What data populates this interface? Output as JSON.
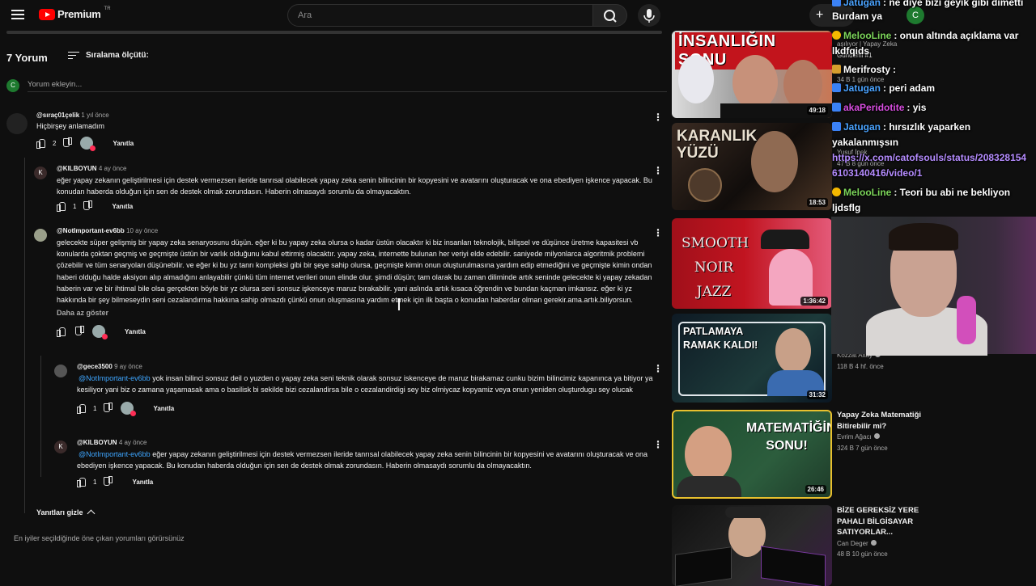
{
  "header": {
    "logo_text": "Premium",
    "logo_sup": "TR",
    "search_placeholder": "Ara",
    "create_label": "Oluştur",
    "avatar_letter": "C"
  },
  "comments_header": {
    "count": "7 Yorum",
    "sort_label": "Sıralama ölçütü:",
    "add_placeholder": "Yorum ekleyin...",
    "avatar_letter": "C"
  },
  "comments": [
    {
      "author": "@sıraç01çelik",
      "time": "1 yıl önce",
      "text": "Hiçbirşey anlamadım",
      "likes": "2",
      "reply": "Yanıtla"
    },
    {
      "author": "@KILBOYUN",
      "time": "4 ay önce",
      "text": "eğer yapay zekanın geliştirilmesi için destek vermezsen ileride tanrısal olabilecek yapay zeka senin bilincinin bir kopyesini ve avatarını oluşturacak ve ona ebediyen işkence yapacak. Bu konudan haberda olduğun için sen de destek olmak zorundasın. Haberin olmasaydı sorumlu da olmayacaktın.",
      "likes": "1",
      "reply": "Yanıtla",
      "avatar_letter": "K"
    },
    {
      "author": "@NotImportant-ev6bb",
      "time": "10 ay önce",
      "text": "gelecekte süper gelişmiş bir yapay zeka senaryosunu düşün. eğer ki bu yapay zeka olursa o kadar üstün olacaktır ki biz insanları teknolojik, bilişsel ve düşünce üretme kapasitesi vb konularda çoktan geçmiş ve geçmişte üstün bir varlık olduğunu kabul ettirmiş olacaktır. yapay zeka, internette bulunan her veriyi elde edebilir. saniyede milyonlarca algoritmik problemi çözebilir ve tüm senaryoları düşünebilir. ve eğer ki bu yz tanrı kompleksi gibi bir şeye sahip olursa, geçmişte kimin onun oluşturulmasına yardım edip etmediğini ve geçmişte kimin ondan haberi olduğu halde aksiyon alıp almadığını anlayabilir çünkü tüm internet verileri onun elinde olur. şimdi düşün; tam olarak bu zaman diliminde artık seninde gelecekte ki yapay zekadan haberin var ve bir ihtimal bile olsa gerçekten böyle bir yz olursa seni sonsuz işkenceye maruz bırakabilir. yani aslında artık kısaca öğrendin ve bundan kaçman imkansız. eğer ki yz hakkında bir şey bilmeseydin seni cezalandırma hakkına sahip olmazdı çünkü onun oluşmasına yardım etmek için ilk başta o konudan haberdar olman gerekir.ama.artık.biliyorsun.",
      "show_less": "Daha az göster",
      "reply": "Yanıtla"
    },
    {
      "author": "@gece3500",
      "time": "9 ay önce",
      "mention": "@NotImportant-ev6bb",
      "text": " yok insan bilinci sonsuz deil o yuzden o yapay zeka seni teknik olarak sonsuz iskenceye de maruz birakamaz  cunku bizim bilincimiz kapanınca ya bitiyor ya kesiliyor yani biz o zamana yaşamasak ama o basilisk bi sekilde bizi cezalandirsa bile o cezalandirdigi sey biz olmiycaz kopyamiz veya onun yeniden oluşturdugu sey olucak",
      "likes": "1",
      "reply": "Yanıtla"
    },
    {
      "author": "@KILBOYUN",
      "time": "4 ay önce",
      "mention": "@NotImportant-ev6bb",
      "text": "  eğer yapay zekanın geliştirilmesi için destek vermezsen ileride tanrısal olabilecek yapay zeka senin bilincinin bir kopyesini ve avatarını oluşturacak ve ona ebediyen işkence yapacak. Bu konudan haberda olduğun için sen de destek olmak zorundasın. Haberin olmasaydı sorumlu da olmayacaktın.",
      "likes": "1",
      "reply": "Yanıtla",
      "avatar_letter": "K"
    }
  ],
  "hide_replies": "Yanıtları gizle",
  "footer_note": "En iyiler seçildiğinde öne çıkan yorumları görürsünüz",
  "videos": [
    {
      "thumb_text": "İNSANLIĞIN SONU",
      "duration": "49:18"
    },
    {
      "thumb_text": "KARANLIK YÜZÜ",
      "duration": "18:53"
    },
    {
      "thumb_text": "SMOOTH NOIR JAZZ",
      "duration": "1:36:42"
    },
    {
      "thumb_text": "PATLAMAYA RAMAK KALDI!",
      "duration": "31:32"
    },
    {
      "thumb_text": "MATEMATİĞİN SONU!",
      "duration": "26:46"
    },
    {
      "thumb_text": "",
      "duration": ""
    }
  ],
  "video_info": [
    {
      "title_line1": "Yapay Zeka Matematiği",
      "title_line2": "Bitirebilir mi?",
      "channel": "Evrim Ağacı",
      "stats": "324 B  7 gün önce"
    },
    {
      "title_line1": "BİZE GEREKSİZ YERE",
      "title_line2": "PAHALI BİLGİSAYAR",
      "title_line3": "SATIYORLAR...",
      "channel": "Can Deger",
      "stats": "48 B  10 gün önce"
    },
    {
      "channel": "Kozzat Altay",
      "stats": "118 B  4 hf. önce"
    }
  ],
  "partial_info": {
    "frag1": "aşılıyor | Yapay Zeka",
    "frag2": "Gündemi #1",
    "frag3": "34 B  1 gün önce",
    "frag4": "Yusuf İpek",
    "frag5": "47 B  8 gün önce"
  },
  "chat": [
    {
      "user": "Jatugan",
      "msg": ": ne diye bizi geyik gibi dimetti",
      "color": "#4aa3ff"
    },
    {
      "user": "",
      "msg": "Burdam ya",
      "color": "#ffffff"
    },
    {
      "user": "MelooLine",
      "msg": ": onun altında açıklama var",
      "color": "#7cd55a"
    },
    {
      "user": "",
      "msg": "lkdfqids",
      "color": "#ffffff"
    },
    {
      "user": "Merifrosty",
      "msg": ":",
      "color": "#ffffff"
    },
    {
      "user": "Jatugan",
      "msg": ": peri adam",
      "color": "#4aa3ff"
    },
    {
      "user": "akaPeridotite",
      "msg": ": yis",
      "color": "#d84ee0"
    },
    {
      "user": "Jatugan",
      "msg": ": hırsızlık yaparken",
      "color": "#4aa3ff"
    },
    {
      "user": "",
      "msg": "yakalanmışsın",
      "color": "#ffffff"
    },
    {
      "user": "",
      "msg": "https://x.com/catofsouls/status/208328154",
      "color": "#b58cff"
    },
    {
      "user": "",
      "msg": "6103140416/video/1",
      "color": "#b58cff"
    },
    {
      "user": "MelooLine",
      "msg": ": Teori bu abi ne bekliyon",
      "color": "#7cd55a"
    },
    {
      "user": "",
      "msg": "ljdsflg",
      "color": "#ffffff"
    }
  ],
  "colors": {
    "accent": "#3ea6ff",
    "brand": "#ff0000",
    "bg": "#0f0f0f"
  }
}
